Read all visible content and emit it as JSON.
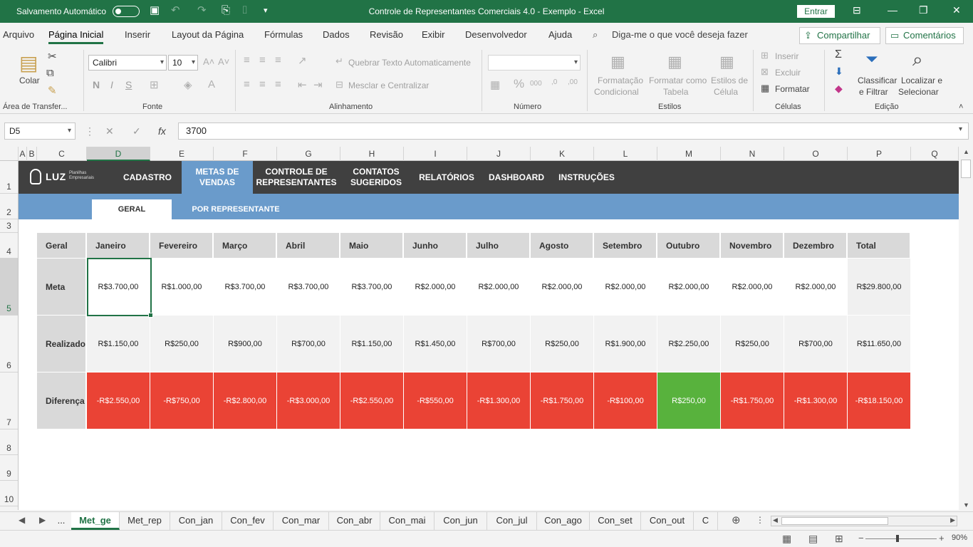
{
  "titlebar": {
    "autosave": "Salvamento Automático",
    "title": "Controle de Representantes Comerciais 4.0 - Exemplo  -  Excel",
    "signin": "Entrar"
  },
  "tabs": [
    "Arquivo",
    "Página Inicial",
    "Inserir",
    "Layout da Página",
    "Fórmulas",
    "Dados",
    "Revisão",
    "Exibir",
    "Desenvolvedor",
    "Ajuda"
  ],
  "active_tab": "Página Inicial",
  "tellme": "Diga-me o que você deseja fazer",
  "share": "Compartilhar",
  "comments": "Comentários",
  "ribbon": {
    "clipboard": {
      "paste": "Colar",
      "label": "Área de Transfer..."
    },
    "font": {
      "name": "Calibri",
      "size": "10",
      "label": "Fonte",
      "bold": "N",
      "italic": "I",
      "underline": "S"
    },
    "alignment": {
      "wrap": "Quebrar Texto Automaticamente",
      "merge": "Mesclar e Centralizar",
      "label": "Alinhamento"
    },
    "number": {
      "format": "",
      "label": "Número"
    },
    "styles": {
      "cond1": "Formatação",
      "cond2": "Condicional",
      "table1": "Formatar como",
      "table2": "Tabela",
      "cell1": "Estilos de",
      "cell2": "Célula",
      "label": "Estilos"
    },
    "cells": {
      "insert": "Inserir",
      "delete": "Excluir",
      "format": "Formatar",
      "label": "Células"
    },
    "editing": {
      "sort1": "Classificar",
      "sort2": "e Filtrar",
      "find1": "Localizar e",
      "find2": "Selecionar",
      "label": "Edição"
    }
  },
  "formula_bar": {
    "namebox": "D5",
    "formula": "3700"
  },
  "columns": [
    "A",
    "B",
    "C",
    "D",
    "E",
    "F",
    "G",
    "H",
    "I",
    "J",
    "K",
    "L",
    "M",
    "N",
    "O",
    "P",
    "Q"
  ],
  "rows": [
    "1",
    "2",
    "3",
    "4",
    "5",
    "6",
    "7",
    "8",
    "9",
    "10"
  ],
  "nav": {
    "logo": "LUZ",
    "logo_sub": "Planilhas Empresariais",
    "items": [
      "CADASTRO",
      "METAS DE VENDAS",
      "CONTROLE DE REPRESENTANTES",
      "CONTATOS SUGERIDOS",
      "RELATÓRIOS",
      "DASHBOARD",
      "INSTRUÇÕES"
    ],
    "sub": [
      "GERAL",
      "POR REPRESENTANTE"
    ]
  },
  "table": {
    "corner": "Geral",
    "months": [
      "Janeiro",
      "Fevereiro",
      "Março",
      "Abril",
      "Maio",
      "Junho",
      "Julho",
      "Agosto",
      "Setembro",
      "Outubro",
      "Novembro",
      "Dezembro",
      "Total"
    ],
    "rows": [
      {
        "label": "Meta",
        "values": [
          "R$3.700,00",
          "R$1.000,00",
          "R$3.700,00",
          "R$3.700,00",
          "R$3.700,00",
          "R$2.000,00",
          "R$2.000,00",
          "R$2.000,00",
          "R$2.000,00",
          "R$2.000,00",
          "R$2.000,00",
          "R$2.000,00",
          "R$29.800,00"
        ]
      },
      {
        "label": "Realizado",
        "values": [
          "R$1.150,00",
          "R$250,00",
          "R$900,00",
          "R$700,00",
          "R$1.150,00",
          "R$1.450,00",
          "R$700,00",
          "R$250,00",
          "R$1.900,00",
          "R$2.250,00",
          "R$250,00",
          "R$700,00",
          "R$11.650,00"
        ]
      },
      {
        "label": "Diferença",
        "values": [
          "-R$2.550,00",
          "-R$750,00",
          "-R$2.800,00",
          "-R$3.000,00",
          "-R$2.550,00",
          "-R$550,00",
          "-R$1.300,00",
          "-R$1.750,00",
          "-R$100,00",
          "R$250,00",
          "-R$1.750,00",
          "-R$1.300,00",
          "-R$18.150,00"
        ]
      }
    ]
  },
  "sheets": [
    "...",
    "Met_ge",
    "Met_rep",
    "Con_jan",
    "Con_fev",
    "Con_mar",
    "Con_abr",
    "Con_mai",
    "Con_jun",
    "Con_jul",
    "Con_ago",
    "Con_set",
    "Con_out",
    "C"
  ],
  "active_sheet": "Met_ge",
  "zoom": "90%",
  "colors": {
    "accent": "#217346",
    "nav_dark": "#404040",
    "nav_blue": "#6a9bcb",
    "negative": "#ea4335",
    "positive": "#58b23d"
  }
}
